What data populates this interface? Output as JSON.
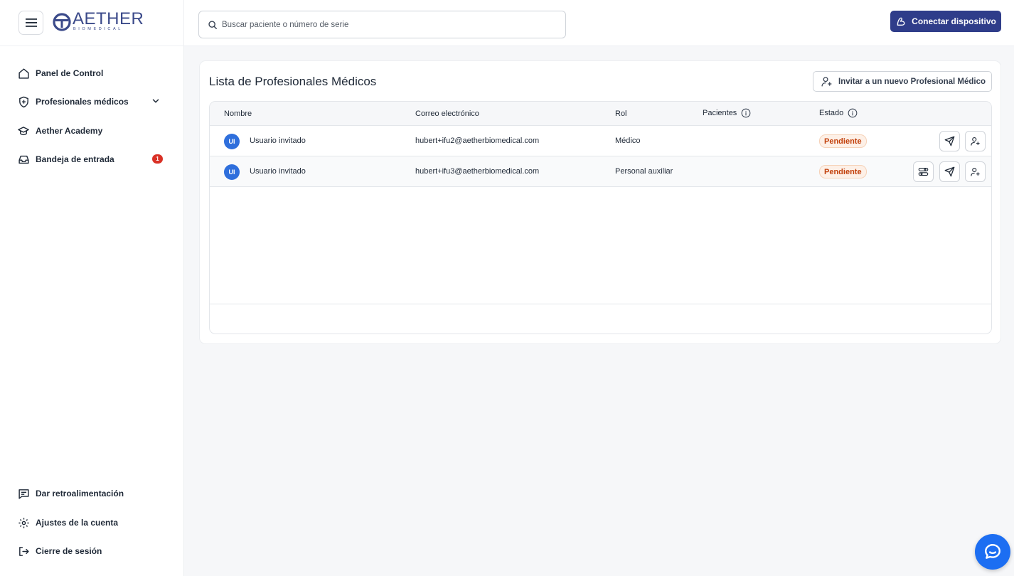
{
  "app": {
    "logo_text": "AETHER",
    "logo_subtext": "BIOMEDICAL",
    "accent_color": "#2f3d8a"
  },
  "sidebar": {
    "items": [
      {
        "label": "Panel de Control",
        "icon": "home-icon"
      },
      {
        "label": "Profesionales médicos",
        "icon": "shield-plus-icon",
        "expandable": true
      },
      {
        "label": "Aether Academy",
        "icon": "graduation-cap-icon"
      },
      {
        "label": "Bandeja de entrada",
        "icon": "inbox-icon",
        "badge": "1"
      }
    ],
    "bottom_items": [
      {
        "label": "Dar retroalimentación",
        "icon": "feedback-icon"
      },
      {
        "label": "Ajustes de la cuenta",
        "icon": "gear-icon"
      },
      {
        "label": "Cierre de sesión",
        "icon": "logout-icon"
      }
    ]
  },
  "header": {
    "search_placeholder": "Buscar paciente o número de serie",
    "connect_label": "Conectar dispositivo"
  },
  "main": {
    "title": "Lista de Profesionales Médicos",
    "invite_label": "Invitar a un nuevo Profesional Médico",
    "columns": [
      "Nombre",
      "Correo electrónico",
      "Rol",
      "Pacientes",
      "Estado"
    ],
    "rows": [
      {
        "initials": "UI",
        "name": "Usuario invitado",
        "email": "hubert+ifu2@aetherbiomedical.com",
        "role": "Médico",
        "patients": "",
        "status": "Pendiente"
      },
      {
        "initials": "UI",
        "name": "Usuario invitado",
        "email": "hubert+ifu3@aetherbiomedical.com",
        "role": "Personal auxiliar",
        "patients": "",
        "status": "Pendiente"
      }
    ]
  }
}
